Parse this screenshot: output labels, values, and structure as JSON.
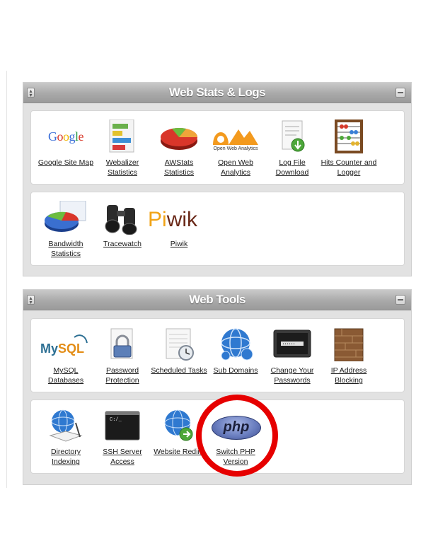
{
  "colors": {
    "panel_bg": "#e2e2e2",
    "header_gradient_top": "#c9c9c9",
    "header_gradient_bottom": "#9a9a9a",
    "highlight_circle": "#e60000"
  },
  "web_stats": {
    "title": "Web Stats & Logs",
    "row1": [
      {
        "icon": "google-logo",
        "logo_text": "Google",
        "label": "Google Site Map"
      },
      {
        "icon": "webalizer-chart-icon",
        "label": "Webalizer Statistics"
      },
      {
        "icon": "awstats-pie-icon",
        "label": "AWStats Statistics"
      },
      {
        "icon": "open-web-analytics-icon",
        "logo_text": "Open Web Analytics",
        "label": "Open Web Analytics"
      },
      {
        "icon": "log-download-icon",
        "label": "Log File Download"
      },
      {
        "icon": "abacus-icon",
        "label": "Hits Counter and Logger"
      }
    ],
    "row2": [
      {
        "icon": "bandwidth-pie-icon",
        "label": "Bandwidth Statistics"
      },
      {
        "icon": "binoculars-icon",
        "label": "Tracewatch"
      },
      {
        "icon": "piwik-logo",
        "logo_text": "Piwik",
        "label": "Piwik"
      }
    ]
  },
  "web_tools": {
    "title": "Web Tools",
    "row1": [
      {
        "icon": "mysql-logo",
        "logo_text": "MySQL",
        "label": "MySQL Databases"
      },
      {
        "icon": "lock-document-icon",
        "label": "Password Protection"
      },
      {
        "icon": "clock-document-icon",
        "label": "Scheduled Tasks"
      },
      {
        "icon": "globe-icon",
        "label": "Sub Domains"
      },
      {
        "icon": "password-screen-icon",
        "label": "Change Your Passwords"
      },
      {
        "icon": "brick-wall-icon",
        "label": "IP Address Blocking"
      }
    ],
    "row2": [
      {
        "icon": "globe-book-icon",
        "label": "Directory Indexing"
      },
      {
        "icon": "terminal-icon",
        "terminal_text": "C:/_",
        "label": "SSH Server Access"
      },
      {
        "icon": "globe-redirect-icon",
        "label": "Website Redire"
      },
      {
        "icon": "php-logo",
        "logo_text": "php",
        "label": "Switch PHP Version"
      }
    ]
  }
}
